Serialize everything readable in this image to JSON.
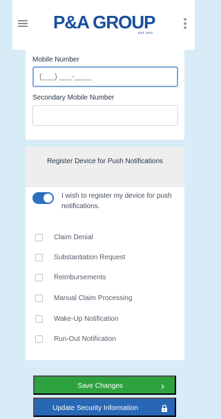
{
  "header": {
    "logo_text": "P&A GROUP",
    "logo_tagline": "EST. 1973",
    "menu_icon": "hamburger-menu-icon",
    "more_icon": "vertical-ellipsis-icon"
  },
  "contact": {
    "mobile_label": "Mobile Number",
    "mobile_value": "(___) ___-____",
    "secondary_label": "Secondary Mobile Number",
    "secondary_value": ""
  },
  "push_notifications": {
    "title": "Register Device for Push Notifications",
    "toggle_text": "I wish to register my device for push notifications.",
    "toggle_on": true,
    "options": [
      "Claim Denial",
      "Substantiation Request",
      "Reimbursements",
      "Manual Claim Processing",
      "Wake-Up Notification",
      "Run-Out Notification"
    ]
  },
  "actions": {
    "save_label": "Save Changes",
    "security_label": "Update Security Information"
  },
  "colors": {
    "background": "#d7ecf7",
    "primary_blue": "#2867b4",
    "green": "#2da23e"
  }
}
